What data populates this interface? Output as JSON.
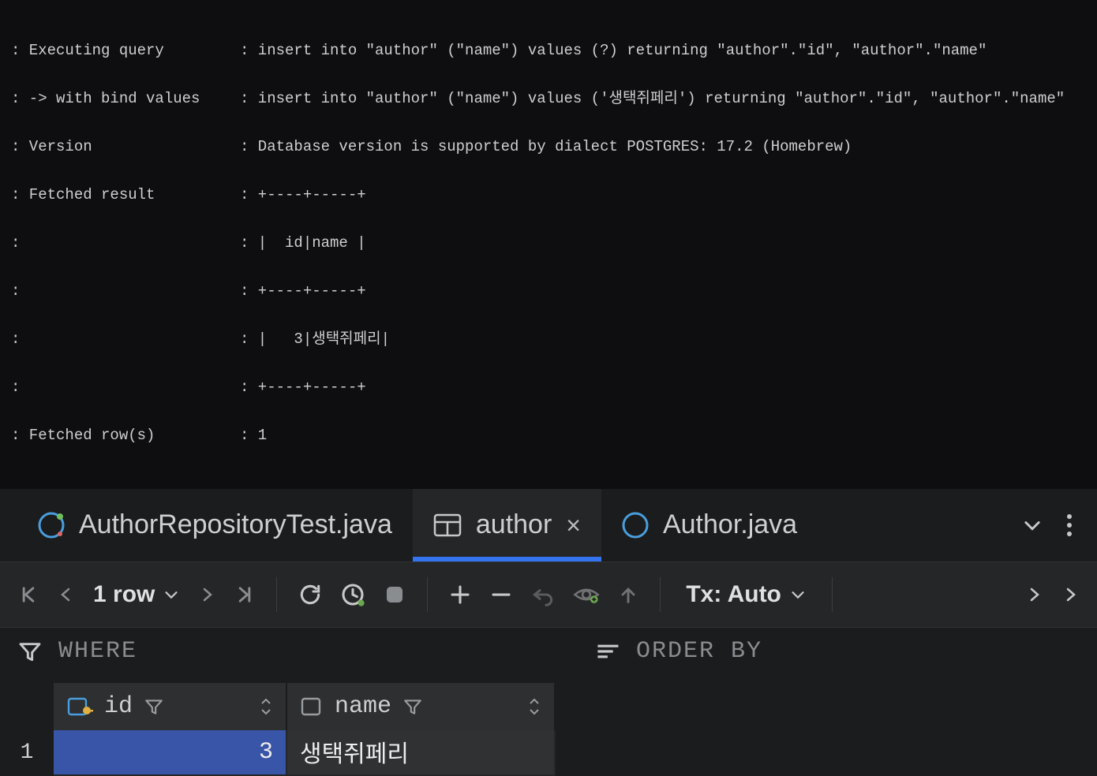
{
  "console": {
    "lines": [
      {
        "label": ": Executing query",
        "value": ": insert into \"author\" (\"name\") values (?) returning \"author\".\"id\", \"author\".\"name\""
      },
      {
        "label": ": -> with bind values",
        "value": ": insert into \"author\" (\"name\") values ('생택쥐페리') returning \"author\".\"id\", \"author\".\"name\""
      },
      {
        "label": ": Version",
        "value": ": Database version is supported by dialect POSTGRES: 17.2 (Homebrew)"
      },
      {
        "label": ": Fetched result",
        "value": ": +----+-----+"
      },
      {
        "label": ":",
        "value": ": |  id|name |"
      },
      {
        "label": ":",
        "value": ": +----+-----+"
      },
      {
        "label": ":",
        "value": ": |   3|생택쥐페리|"
      },
      {
        "label": ":",
        "value": ": +----+-----+"
      },
      {
        "label": ": Fetched row(s)",
        "value": ": 1"
      }
    ]
  },
  "tabs": {
    "items": [
      {
        "label": "AuthorRepositoryTest.java",
        "icon": "class"
      },
      {
        "label": "author",
        "icon": "table",
        "active": true,
        "closable": true
      },
      {
        "label": "Author.java",
        "icon": "class"
      }
    ]
  },
  "toolbar": {
    "row_count": "1 row",
    "tx_label": "Tx: Auto"
  },
  "filter": {
    "where_label": "WHERE",
    "orderby_label": "ORDER BY"
  },
  "grid": {
    "columns": [
      {
        "name": "id",
        "pk": true
      },
      {
        "name": "name",
        "pk": false
      }
    ],
    "rows": [
      {
        "num": "1",
        "id": "3",
        "name": "생택쥐페리"
      }
    ]
  },
  "icons": {
    "chevron_down": "chevron-down",
    "kebab": "kebab"
  }
}
